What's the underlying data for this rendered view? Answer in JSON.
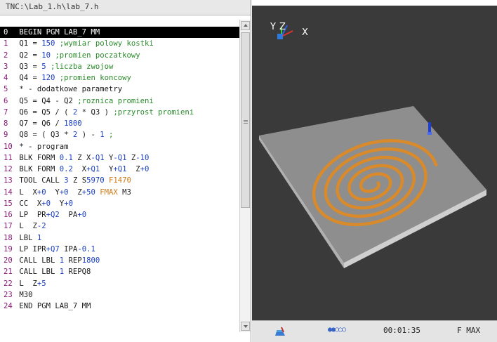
{
  "editor": {
    "path": "TNC:\\Lab_1.h\\lab_7.h",
    "lines": [
      {
        "num": "0",
        "parts": [
          {
            "t": " BEGIN PGM LAB_7 MM",
            "c": ""
          }
        ]
      },
      {
        "num": "1",
        "parts": [
          {
            "t": " Q1 = ",
            "c": ""
          },
          {
            "t": "150",
            "c": "n"
          },
          {
            "t": " ;wymiar polowy kostki",
            "c": "c"
          }
        ]
      },
      {
        "num": "2",
        "parts": [
          {
            "t": " Q2 = ",
            "c": ""
          },
          {
            "t": "10",
            "c": "n"
          },
          {
            "t": " ;promien poczatkowy",
            "c": "c"
          }
        ]
      },
      {
        "num": "3",
        "parts": [
          {
            "t": " Q3 = ",
            "c": ""
          },
          {
            "t": "5",
            "c": "n"
          },
          {
            "t": " ;liczba zwojow",
            "c": "c"
          }
        ]
      },
      {
        "num": "4",
        "parts": [
          {
            "t": " Q4 = ",
            "c": ""
          },
          {
            "t": "120",
            "c": "n"
          },
          {
            "t": " ;promien koncowy",
            "c": "c"
          }
        ]
      },
      {
        "num": "5",
        "parts": [
          {
            "t": " * - dodatkowe parametry",
            "c": ""
          }
        ]
      },
      {
        "num": "6",
        "parts": [
          {
            "t": " Q5 = Q4 - Q2 ",
            "c": ""
          },
          {
            "t": ";roznica promieni",
            "c": "c"
          }
        ]
      },
      {
        "num": "7",
        "parts": [
          {
            "t": " Q6 = Q5 / ( ",
            "c": ""
          },
          {
            "t": "2",
            "c": "n"
          },
          {
            "t": " * Q3 ) ",
            "c": ""
          },
          {
            "t": ";przyrost promieni",
            "c": "c"
          }
        ]
      },
      {
        "num": "8",
        "parts": [
          {
            "t": " Q7 = Q6 / ",
            "c": ""
          },
          {
            "t": "1800",
            "c": "n"
          }
        ]
      },
      {
        "num": "9",
        "parts": [
          {
            "t": " Q8 = ( Q3 * ",
            "c": ""
          },
          {
            "t": "2",
            "c": "n"
          },
          {
            "t": " ) - ",
            "c": ""
          },
          {
            "t": "1",
            "c": "n"
          },
          {
            "t": " ;",
            "c": "c"
          }
        ]
      },
      {
        "num": "10",
        "parts": [
          {
            "t": " * - program",
            "c": ""
          }
        ]
      },
      {
        "num": "11",
        "parts": [
          {
            "t": " BLK FORM ",
            "c": ""
          },
          {
            "t": "0.1",
            "c": "n"
          },
          {
            "t": " Z X",
            "c": ""
          },
          {
            "t": "-Q1",
            "c": "n"
          },
          {
            "t": " Y",
            "c": ""
          },
          {
            "t": "-Q1",
            "c": "n"
          },
          {
            "t": " Z",
            "c": ""
          },
          {
            "t": "-10",
            "c": "n"
          }
        ]
      },
      {
        "num": "12",
        "parts": [
          {
            "t": " BLK FORM ",
            "c": ""
          },
          {
            "t": "0.2",
            "c": "n"
          },
          {
            "t": "  X",
            "c": ""
          },
          {
            "t": "+Q1",
            "c": "n"
          },
          {
            "t": "  Y",
            "c": ""
          },
          {
            "t": "+Q1",
            "c": "n"
          },
          {
            "t": "  Z",
            "c": ""
          },
          {
            "t": "+0",
            "c": "n"
          }
        ]
      },
      {
        "num": "13",
        "parts": [
          {
            "t": " TOOL CALL ",
            "c": ""
          },
          {
            "t": "3",
            "c": "n"
          },
          {
            "t": " Z S",
            "c": ""
          },
          {
            "t": "5970",
            "c": "n"
          },
          {
            "t": " F",
            "c": "o"
          },
          {
            "t": "1470",
            "c": "o"
          }
        ]
      },
      {
        "num": "14",
        "parts": [
          {
            "t": " L  X",
            "c": ""
          },
          {
            "t": "+0",
            "c": "n"
          },
          {
            "t": "  Y",
            "c": ""
          },
          {
            "t": "+0",
            "c": "n"
          },
          {
            "t": "  Z",
            "c": ""
          },
          {
            "t": "+50",
            "c": "n"
          },
          {
            "t": " FMAX",
            "c": "o"
          },
          {
            "t": " M3",
            "c": ""
          }
        ]
      },
      {
        "num": "15",
        "parts": [
          {
            "t": " CC  X",
            "c": ""
          },
          {
            "t": "+0",
            "c": "n"
          },
          {
            "t": "  Y",
            "c": ""
          },
          {
            "t": "+0",
            "c": "n"
          }
        ]
      },
      {
        "num": "16",
        "parts": [
          {
            "t": " LP  PR",
            "c": ""
          },
          {
            "t": "+Q2",
            "c": "n"
          },
          {
            "t": "  PA",
            "c": ""
          },
          {
            "t": "+0",
            "c": "n"
          }
        ]
      },
      {
        "num": "17",
        "parts": [
          {
            "t": " L  Z",
            "c": ""
          },
          {
            "t": "-2",
            "c": "n"
          }
        ]
      },
      {
        "num": "18",
        "parts": [
          {
            "t": " LBL ",
            "c": ""
          },
          {
            "t": "1",
            "c": "n"
          }
        ]
      },
      {
        "num": "19",
        "parts": [
          {
            "t": " LP IPR",
            "c": ""
          },
          {
            "t": "+Q7",
            "c": "n"
          },
          {
            "t": " IPA",
            "c": ""
          },
          {
            "t": "-0.1",
            "c": "n"
          }
        ]
      },
      {
        "num": "20",
        "parts": [
          {
            "t": " CALL LBL ",
            "c": ""
          },
          {
            "t": "1",
            "c": "n"
          },
          {
            "t": " REP",
            "c": ""
          },
          {
            "t": "1800",
            "c": "n"
          }
        ]
      },
      {
        "num": "21",
        "parts": [
          {
            "t": " CALL LBL ",
            "c": ""
          },
          {
            "t": "1",
            "c": "n"
          },
          {
            "t": " REPQ8",
            "c": ""
          }
        ]
      },
      {
        "num": "22",
        "parts": [
          {
            "t": " L  Z",
            "c": ""
          },
          {
            "t": "+5",
            "c": "n"
          }
        ]
      },
      {
        "num": "23",
        "parts": [
          {
            "t": " M30",
            "c": ""
          }
        ]
      },
      {
        "num": "24",
        "parts": [
          {
            "t": " END PGM LAB_7 MM",
            "c": ""
          }
        ]
      }
    ],
    "selected_line": 0
  },
  "viewport": {
    "axis_labels": {
      "y": "Y",
      "z": "Z",
      "x": "X"
    },
    "colors": {
      "background": "#3a3a3a",
      "workpiece_top": "#8e8e8e",
      "workpiece_side": "#c4c4c4",
      "toolpath": "#d98a2a",
      "tool": "#1e3fd0"
    }
  },
  "status": {
    "tool_icon": "simulation-tool-icon",
    "progress_dots": "●●○○○",
    "elapsed_time": "00:01:35",
    "feed_mode": "F MAX"
  }
}
